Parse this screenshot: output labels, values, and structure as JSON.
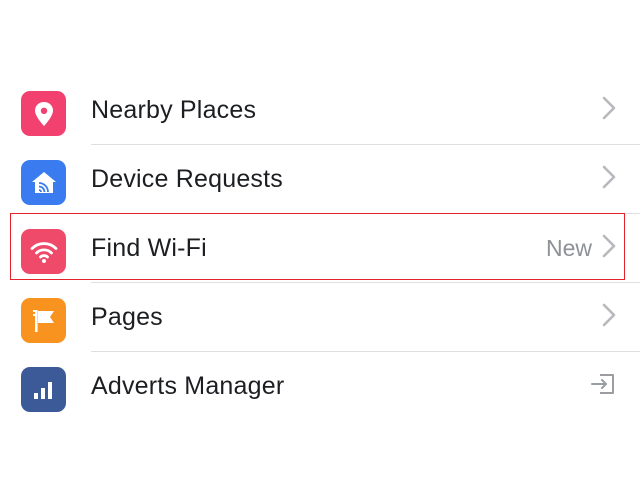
{
  "menu": {
    "items": [
      {
        "label": "Nearby Places",
        "icon": "location-pin-icon",
        "icon_color": "#f2416f",
        "trailing": "chevron-right-icon",
        "badge": ""
      },
      {
        "label": "Device Requests",
        "icon": "device-home-icon",
        "icon_color": "#3b7bf0",
        "trailing": "chevron-right-icon",
        "badge": ""
      },
      {
        "label": "Find Wi-Fi",
        "icon": "wifi-icon",
        "icon_color": "#ef4a6a",
        "trailing": "chevron-right-icon",
        "badge": "New",
        "highlighted": true
      },
      {
        "label": "Pages",
        "icon": "flag-icon",
        "icon_color": "#f7931e",
        "trailing": "chevron-right-icon",
        "badge": ""
      },
      {
        "label": "Adverts Manager",
        "icon": "bar-chart-icon",
        "icon_color": "#3d5a98",
        "trailing": "external-link-icon",
        "badge": ""
      }
    ]
  },
  "highlight_color": "#e3222b"
}
